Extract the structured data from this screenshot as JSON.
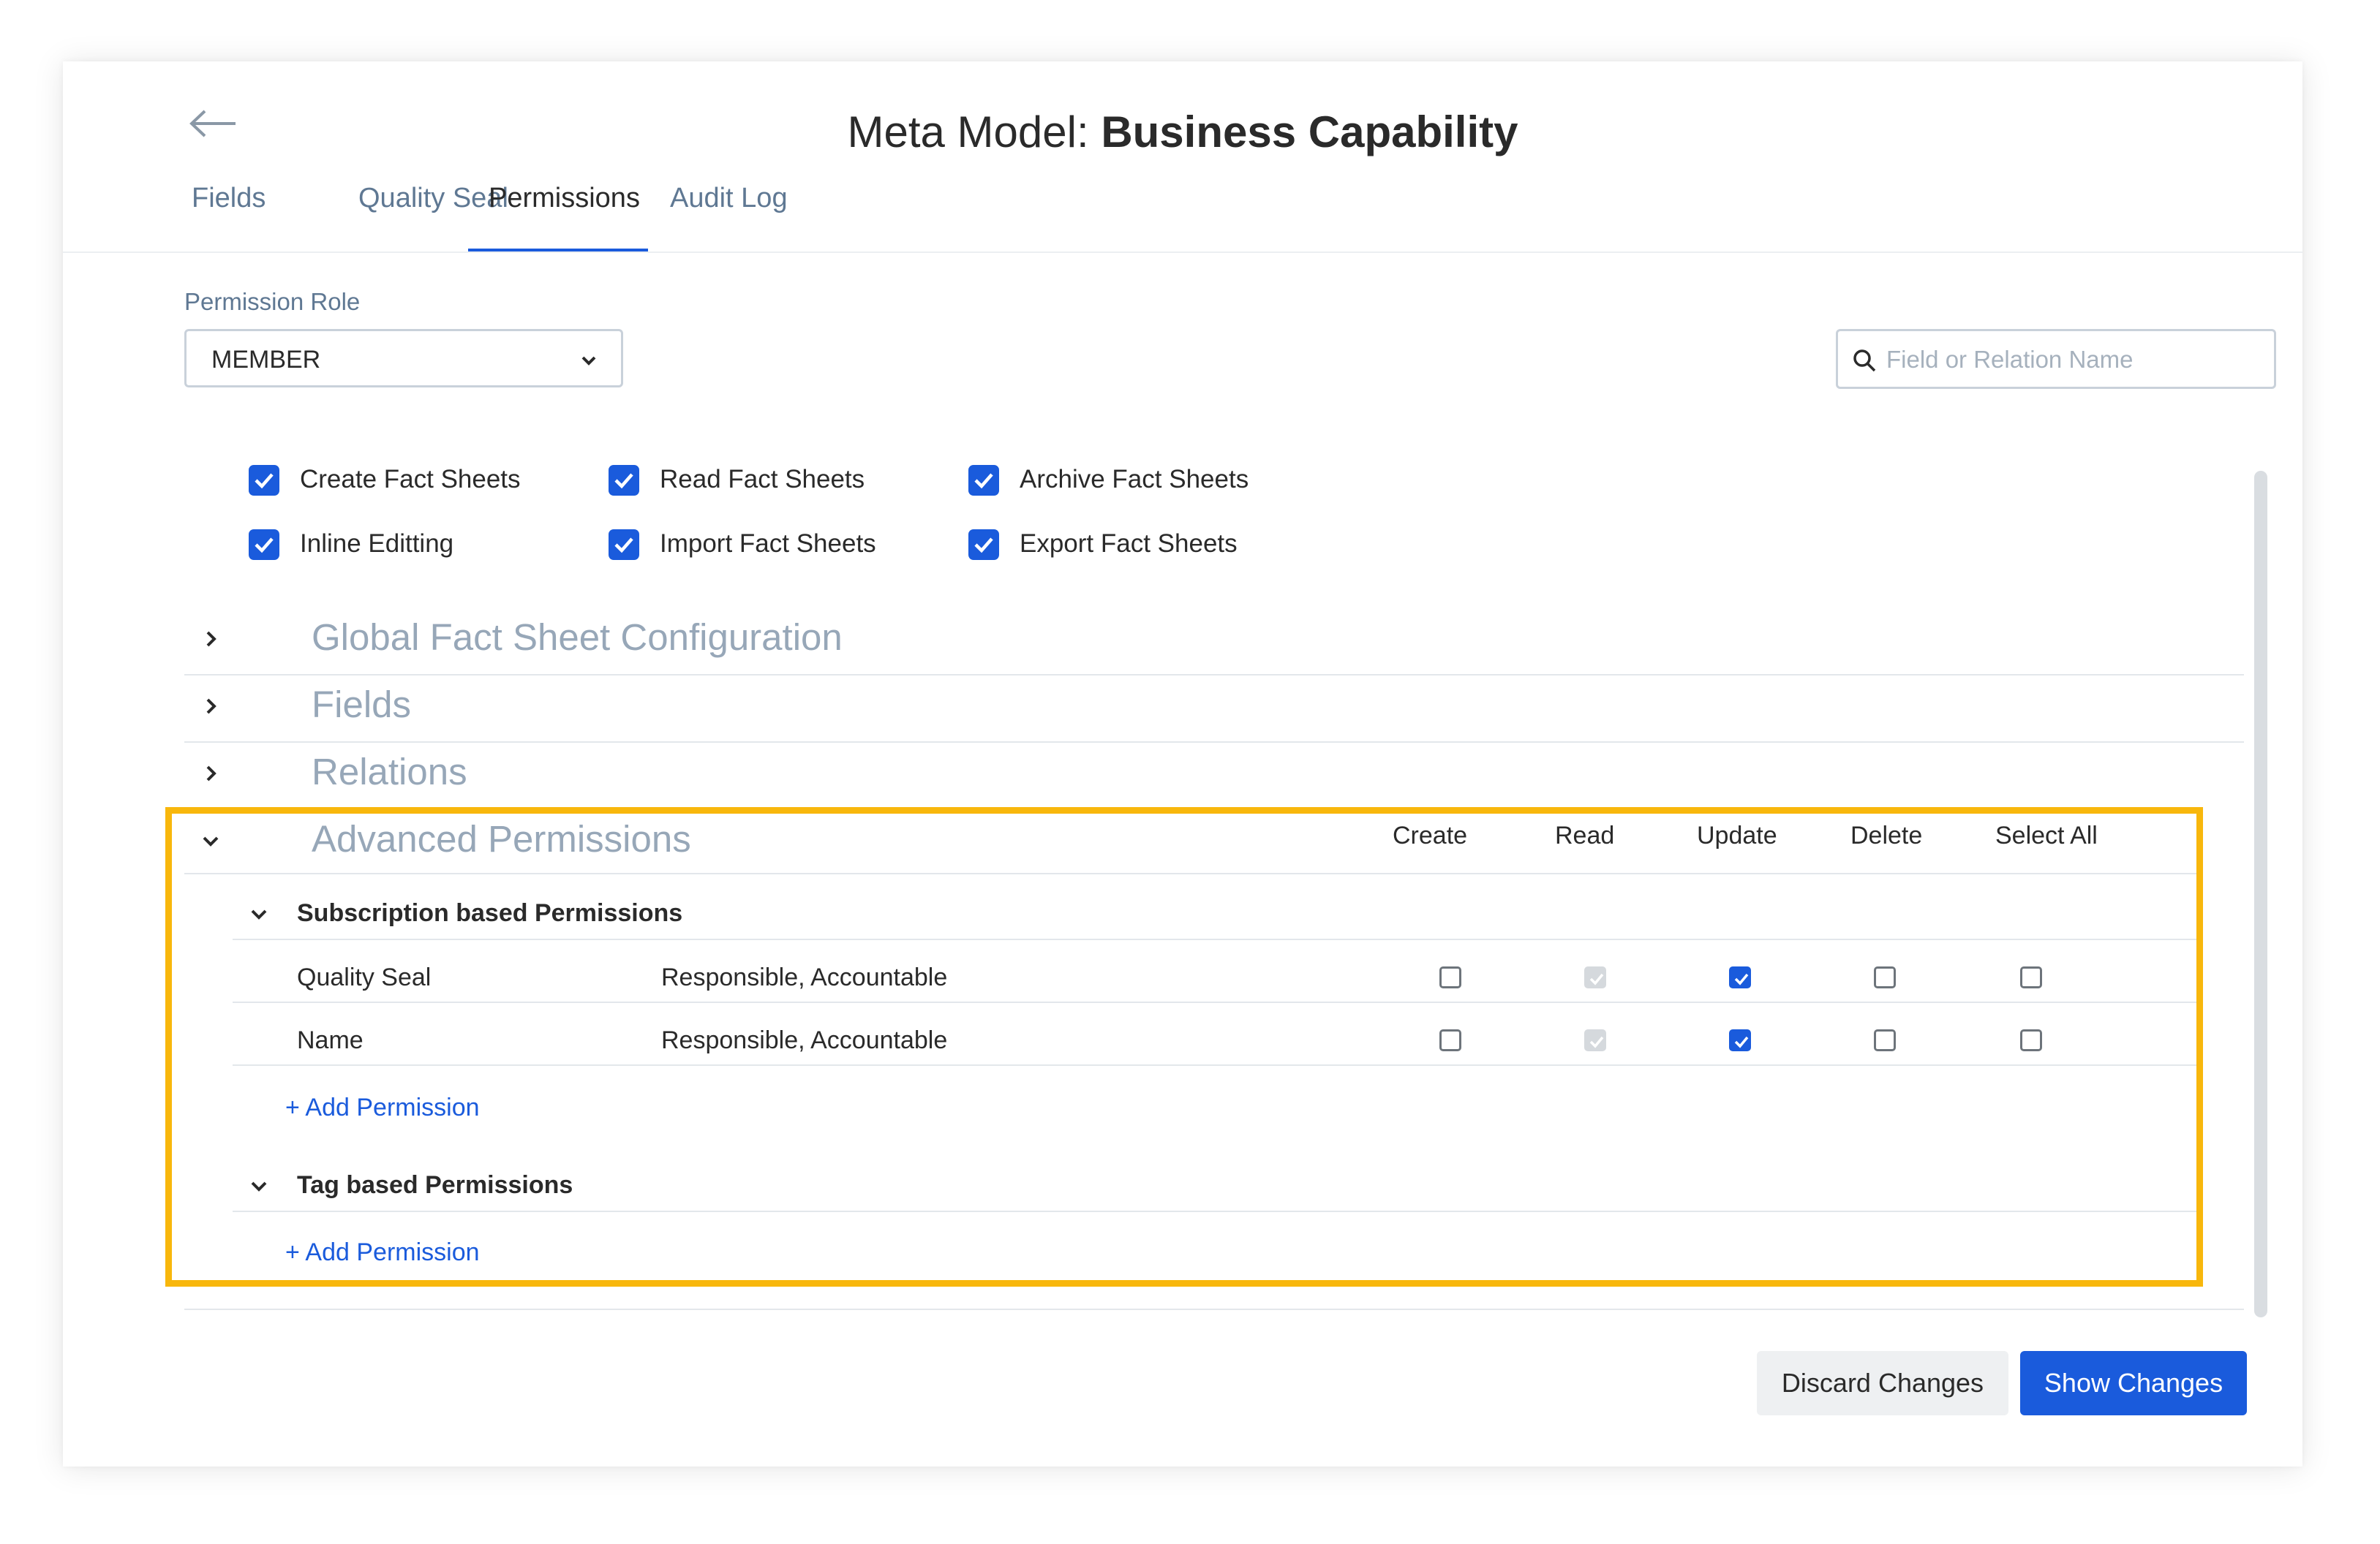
{
  "header": {
    "title_prefix": "Meta Model:",
    "title_bold": "Business Capability"
  },
  "tabs": [
    {
      "label": "Fields"
    },
    {
      "label": "Quality Seal"
    },
    {
      "label": "Permissions",
      "active": true
    },
    {
      "label": "Audit Log"
    }
  ],
  "role": {
    "label": "Permission Role",
    "value": "MEMBER"
  },
  "search": {
    "placeholder": "Field or Relation Name",
    "value": ""
  },
  "general_permissions": [
    {
      "label": "Create Fact Sheets",
      "checked": true
    },
    {
      "label": "Read Fact Sheets",
      "checked": true
    },
    {
      "label": "Archive Fact Sheets",
      "checked": true
    },
    {
      "label": "Inline Editting",
      "checked": true
    },
    {
      "label": "Import Fact Sheets",
      "checked": true
    },
    {
      "label": "Export Fact Sheets",
      "checked": true
    }
  ],
  "sections": {
    "global": "Global Fact Sheet Configuration",
    "fields": "Fields",
    "relations": "Relations",
    "advanced": "Advanced Permissions"
  },
  "columns": [
    "Create",
    "Read",
    "Update",
    "Delete",
    "Select All"
  ],
  "subscription": {
    "title": "Subscription based Permissions",
    "rows": [
      {
        "name": "Quality Seal",
        "roles": "Responsible, Accountable",
        "create": false,
        "read": "disabled-checked",
        "update": true,
        "delete": false,
        "select_all": false
      },
      {
        "name": "Name",
        "roles": "Responsible, Accountable",
        "create": false,
        "read": "disabled-checked",
        "update": true,
        "delete": false,
        "select_all": false
      }
    ],
    "add_label": "+ Add Permission"
  },
  "tag": {
    "title": "Tag based Permissions",
    "add_label": "+ Add Permission"
  },
  "actions": {
    "discard": "Discard Changes",
    "show": "Show Changes"
  },
  "colors": {
    "accent": "#1a5bdc",
    "highlight": "#f8b70c",
    "muted_heading": "#97a7b8",
    "tab_inactive": "#5f7893"
  }
}
